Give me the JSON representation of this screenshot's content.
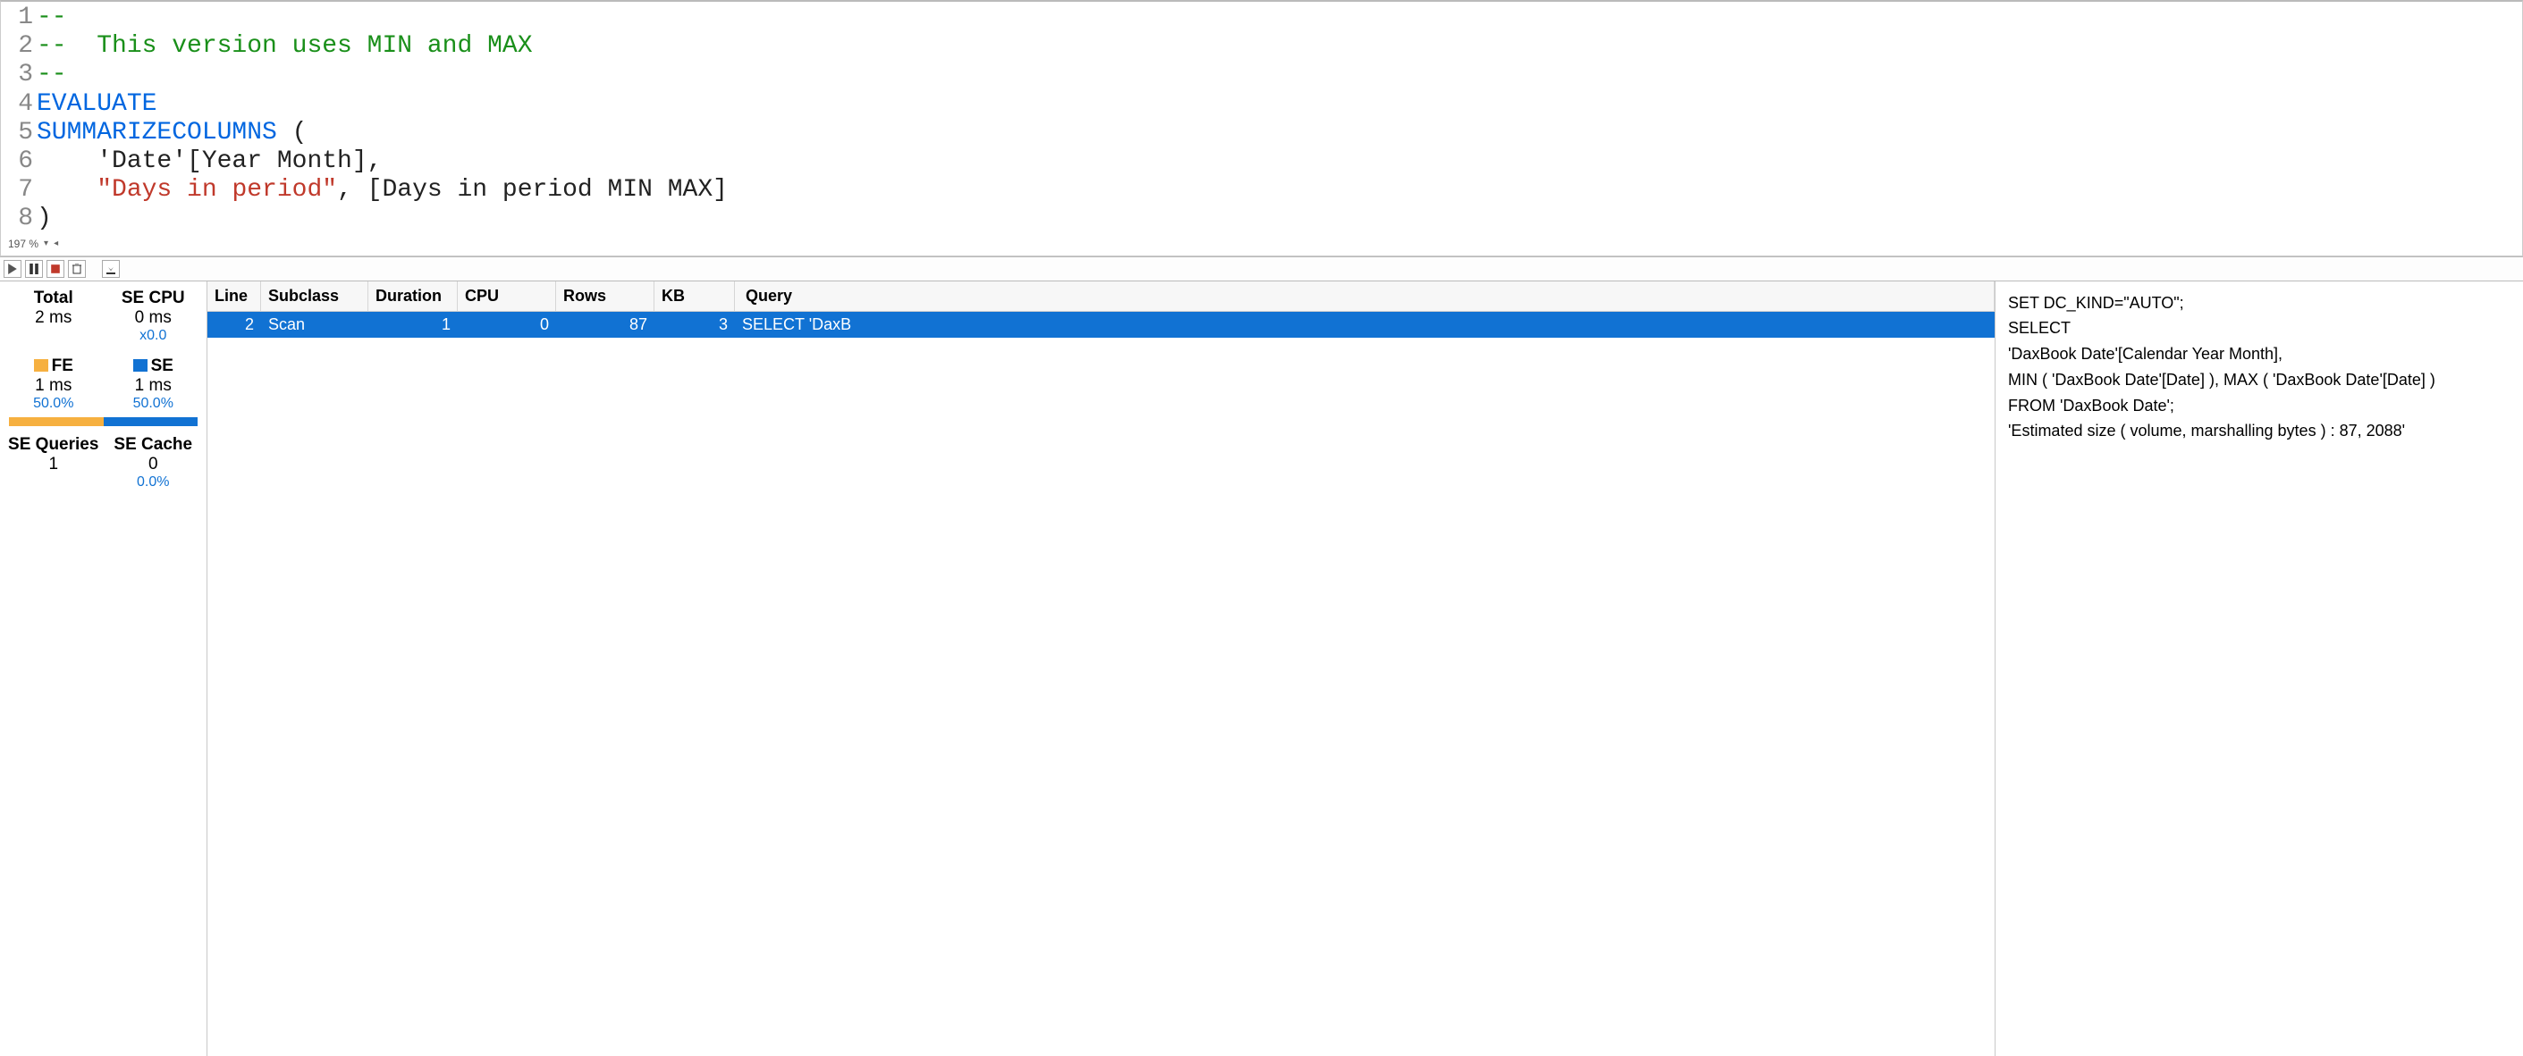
{
  "editor": {
    "lines": [
      {
        "n": 1,
        "segments": [
          {
            "cls": "tok-comment",
            "text": "--"
          }
        ]
      },
      {
        "n": 2,
        "segments": [
          {
            "cls": "tok-comment",
            "text": "--  This version uses MIN and MAX"
          }
        ]
      },
      {
        "n": 3,
        "segments": [
          {
            "cls": "tok-comment",
            "text": "--"
          }
        ]
      },
      {
        "n": 4,
        "segments": [
          {
            "cls": "tok-keyword",
            "text": "EVALUATE"
          }
        ]
      },
      {
        "n": 5,
        "segments": [
          {
            "cls": "tok-keyword",
            "text": "SUMMARIZECOLUMNS"
          },
          {
            "cls": "tok-plain",
            "text": " ("
          }
        ]
      },
      {
        "n": 6,
        "segments": [
          {
            "cls": "tok-plain",
            "text": "    'Date'[Year Month],"
          }
        ]
      },
      {
        "n": 7,
        "segments": [
          {
            "cls": "tok-plain",
            "text": "    "
          },
          {
            "cls": "tok-string",
            "text": "\"Days in period\""
          },
          {
            "cls": "tok-plain",
            "text": ", [Days in period MIN MAX]"
          }
        ]
      },
      {
        "n": 8,
        "segments": [
          {
            "cls": "tok-plain",
            "text": ")"
          }
        ]
      }
    ],
    "zoom": "197 %"
  },
  "stats": {
    "total_label": "Total",
    "total_value": "2 ms",
    "secpu_label": "SE CPU",
    "secpu_value": "0 ms",
    "secpu_ratio": "x0.0",
    "fe_label": "FE",
    "fe_value": "1 ms",
    "fe_pct": "50.0%",
    "se_label": "SE",
    "se_value": "1 ms",
    "se_pct": "50.0%",
    "fe_bar_pct": 50,
    "se_bar_pct": 50,
    "seq_label": "SE Queries",
    "seq_value": "1",
    "secache_label": "SE Cache",
    "secache_value": "0",
    "secache_pct": "0.0%"
  },
  "grid": {
    "headers": {
      "line": "Line",
      "subclass": "Subclass",
      "duration": "Duration",
      "cpu": "CPU",
      "rows": "Rows",
      "kb": "KB",
      "query": "Query"
    },
    "rows": [
      {
        "line": "2",
        "subclass": "Scan",
        "duration": "1",
        "cpu": "0",
        "rows": "87",
        "kb": "3",
        "query": "SELECT 'DaxB"
      }
    ]
  },
  "query_detail": {
    "l1": "SET DC_KIND=\"AUTO\";",
    "l2": "SELECT",
    "l3": "'DaxBook Date'[Calendar Year Month],",
    "l4": "MIN ( 'DaxBook Date'[Date] ), MAX ( 'DaxBook Date'[Date] )",
    "l5": "FROM 'DaxBook Date';",
    "l6": "",
    "l7": "",
    "l8": "'Estimated size ( volume, marshalling bytes ) : 87, 2088'"
  }
}
